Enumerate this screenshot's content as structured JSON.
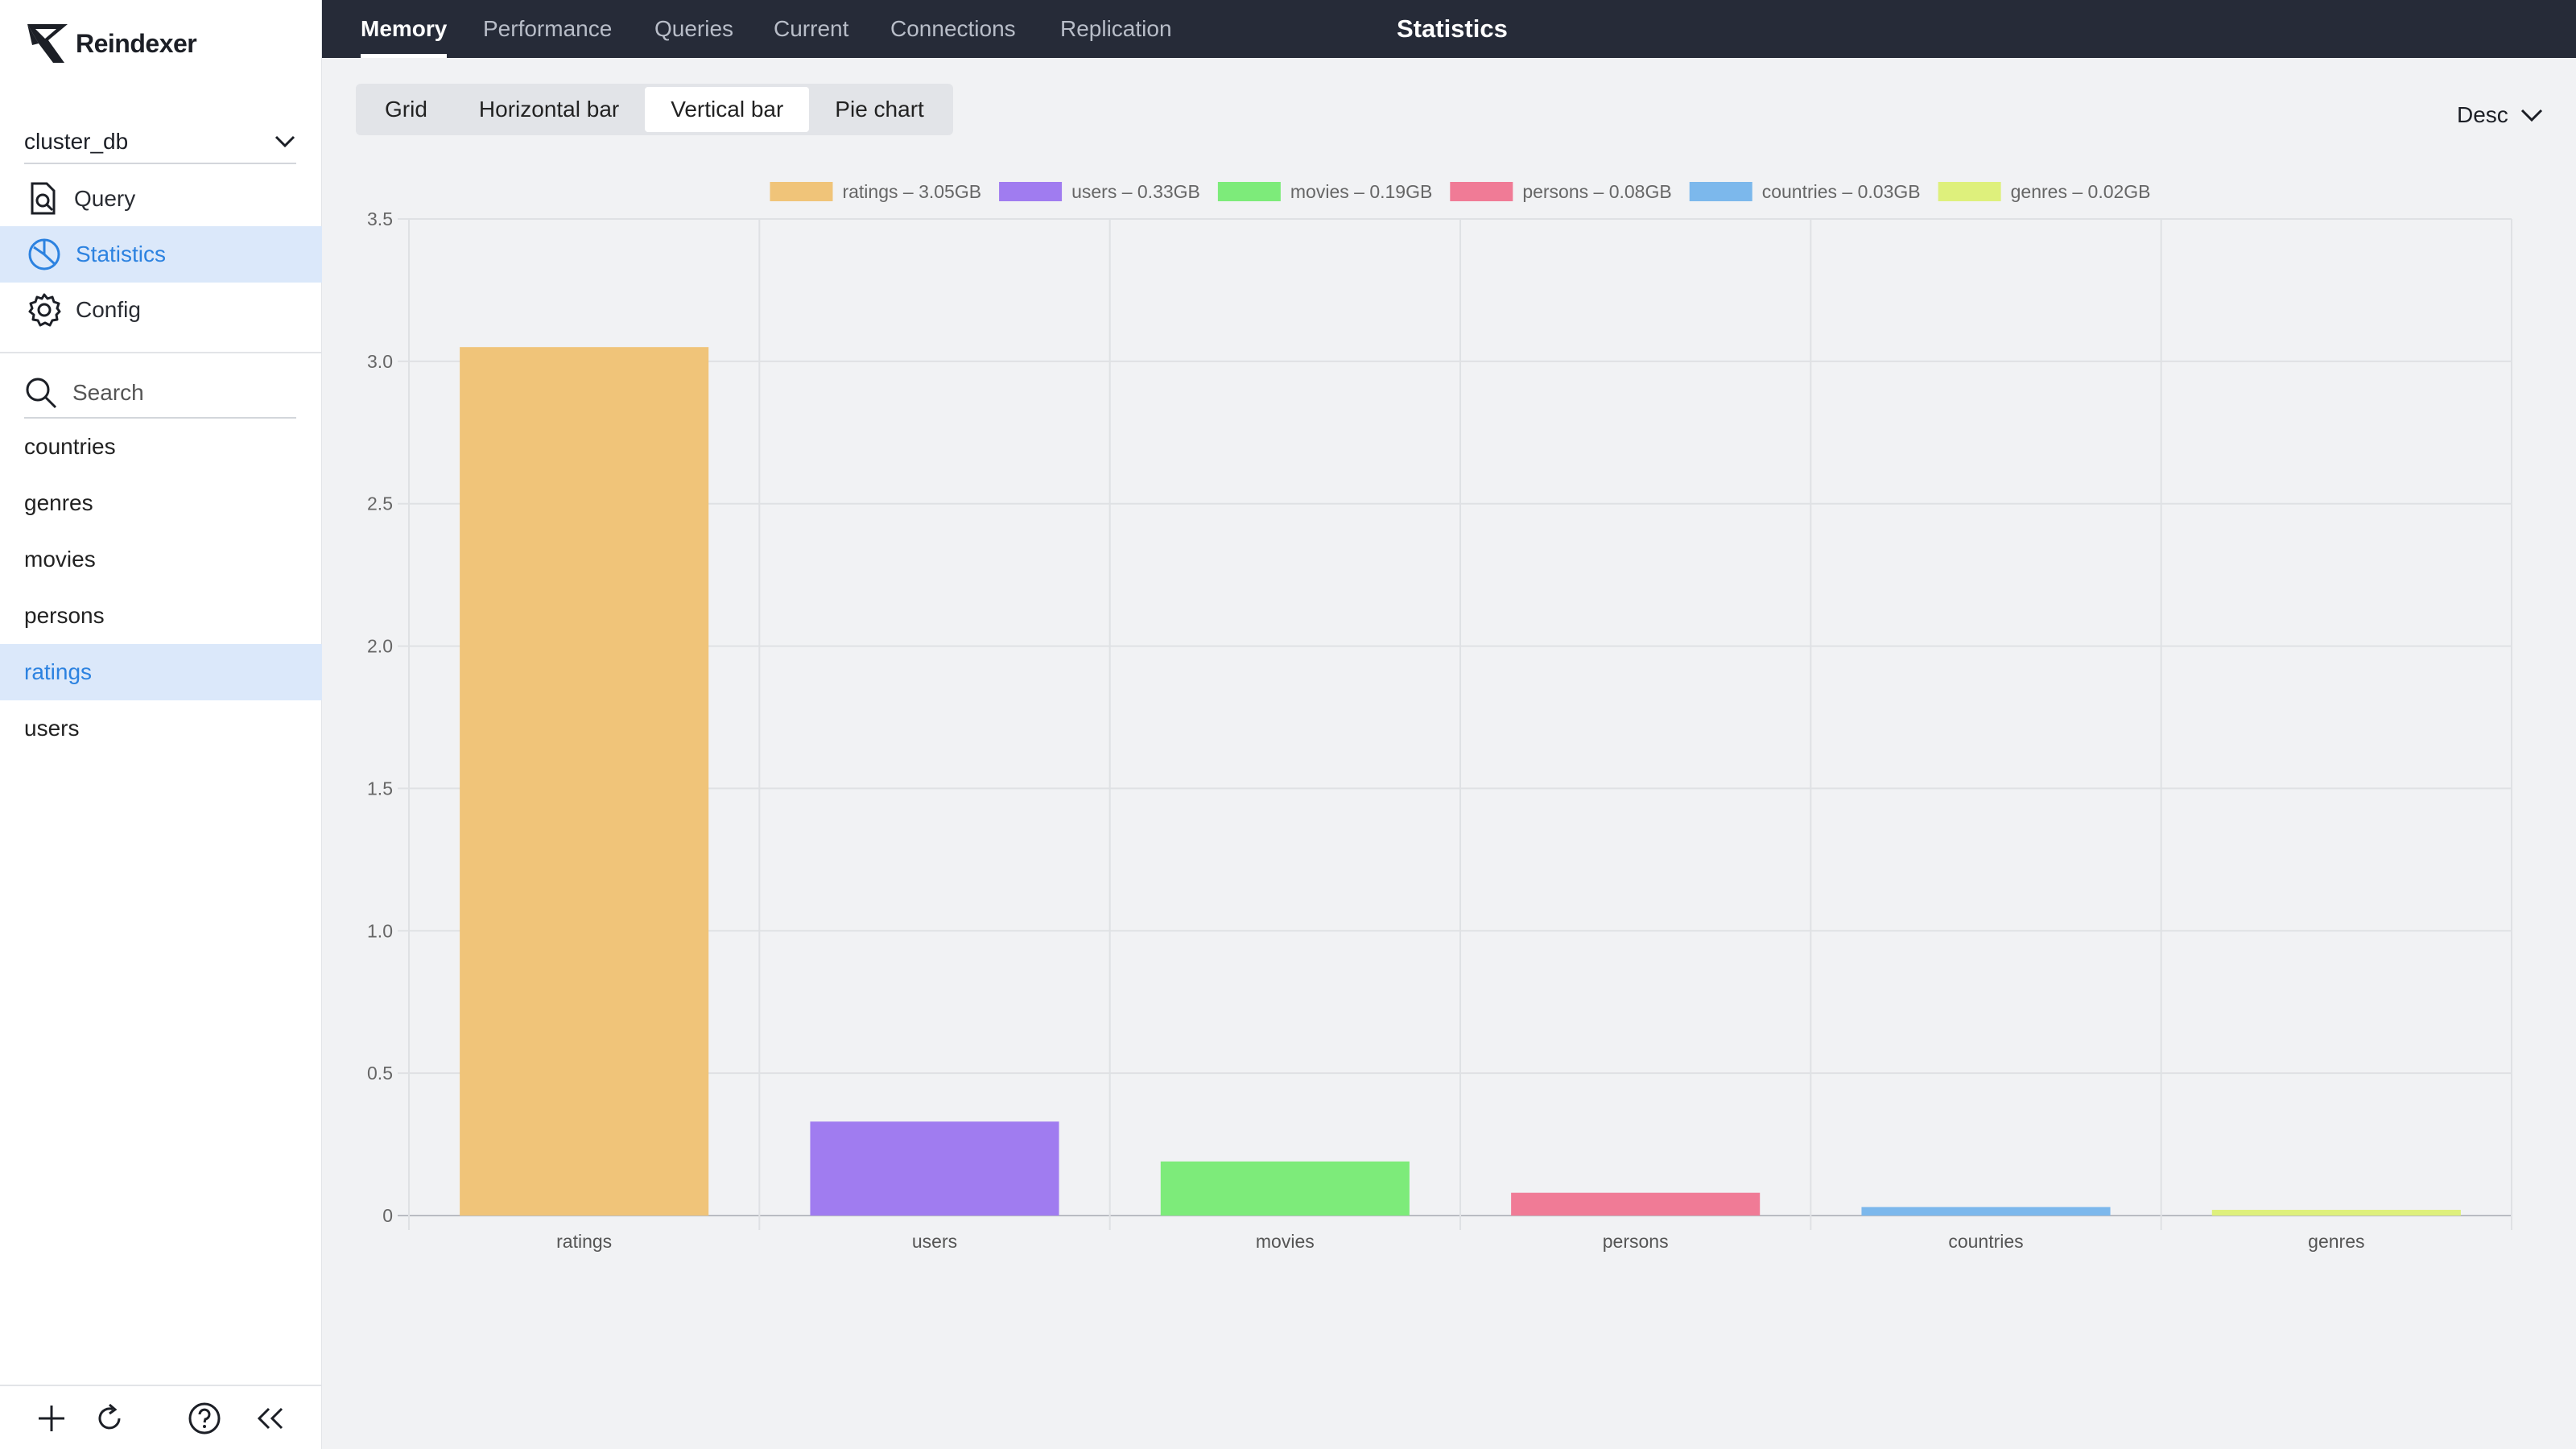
{
  "app": {
    "name": "Reindexer"
  },
  "sidebar": {
    "db_selector": {
      "value": "cluster_db"
    },
    "nav": [
      {
        "label": "Query",
        "icon": "document-search-icon"
      },
      {
        "label": "Statistics",
        "icon": "pie-chart-icon",
        "active": true
      },
      {
        "label": "Config",
        "icon": "gear-icon"
      }
    ],
    "search": {
      "placeholder": "Search"
    },
    "namespaces": [
      {
        "label": "countries"
      },
      {
        "label": "genres"
      },
      {
        "label": "movies"
      },
      {
        "label": "persons"
      },
      {
        "label": "ratings",
        "active": true
      },
      {
        "label": "users"
      }
    ],
    "footer_icons": [
      "plus-icon",
      "refresh-icon",
      "help-icon",
      "collapse-icon"
    ]
  },
  "topbar": {
    "tabs": [
      {
        "label": "Memory",
        "active": true
      },
      {
        "label": "Performance"
      },
      {
        "label": "Queries"
      },
      {
        "label": "Current"
      },
      {
        "label": "Connections"
      },
      {
        "label": "Replication"
      }
    ],
    "title": "Statistics"
  },
  "view_toggle": {
    "options": [
      {
        "label": "Grid"
      },
      {
        "label": "Horizontal bar"
      },
      {
        "label": "Vertical bar",
        "active": true
      },
      {
        "label": "Pie chart"
      }
    ]
  },
  "sort": {
    "value": "Desc"
  },
  "colors": {
    "accent": "#2c82e0",
    "topbar": "#262b38",
    "active_bg": "#dbe8fa"
  },
  "chart_data": {
    "type": "bar",
    "categories": [
      "ratings",
      "users",
      "movies",
      "persons",
      "countries",
      "genres"
    ],
    "values": [
      3.05,
      0.33,
      0.19,
      0.08,
      0.03,
      0.02
    ],
    "legend": [
      "ratings – 3.05GB",
      "users – 0.33GB",
      "movies – 0.19GB",
      "persons – 0.08GB",
      "countries – 0.03GB",
      "genres – 0.02GB"
    ],
    "colors": [
      "#f0c479",
      "#a07cf0",
      "#7deb7a",
      "#f07b96",
      "#7cb8ec",
      "#def07c"
    ],
    "ylim": [
      0,
      3.5
    ],
    "yticks": [
      "0",
      "0.5",
      "1.0",
      "1.5",
      "2.0",
      "2.5",
      "3.0",
      "3.5"
    ],
    "ytick_values": [
      0,
      0.5,
      1.0,
      1.5,
      2.0,
      2.5,
      3.0,
      3.5
    ],
    "grid": true,
    "legend_position": "top"
  }
}
